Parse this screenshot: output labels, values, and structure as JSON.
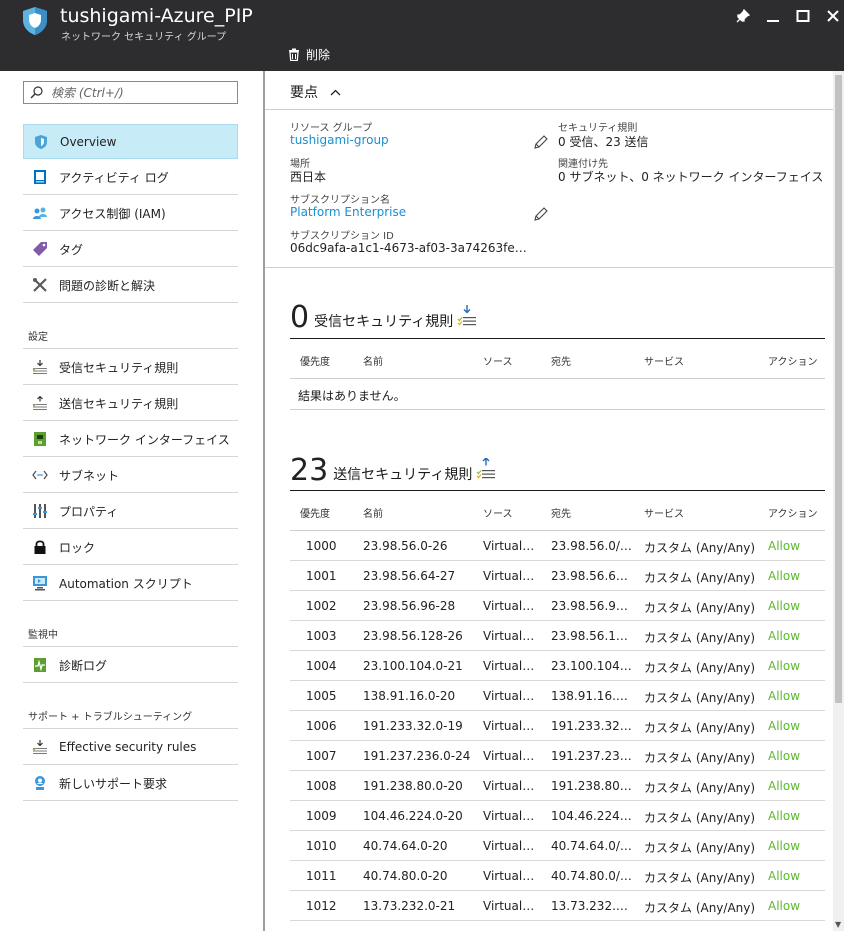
{
  "header": {
    "title": "tushigami-Azure_PIP",
    "subtitle": "ネットワーク セキュリティ グループ",
    "delete_label": "削除"
  },
  "search": {
    "placeholder": "検索 (Ctrl+/)"
  },
  "nav": {
    "overview": "Overview",
    "activity_log": "アクティビティ ログ",
    "iam": "アクセス制御 (IAM)",
    "tags": "タグ",
    "diagnose": "問題の診断と解決",
    "settings_label": "設定",
    "inbound": "受信セキュリティ規則",
    "outbound": "送信セキュリティ規則",
    "nics": "ネットワーク インターフェイス",
    "subnets": "サブネット",
    "properties": "プロパティ",
    "locks": "ロック",
    "automation": "Automation スクリプト",
    "monitoring_label": "監視中",
    "diag_logs": "診断ログ",
    "support_label": "サポート + トラブルシューティング",
    "effective_rules": "Effective security rules",
    "new_support": "新しいサポート要求"
  },
  "essentials": {
    "heading": "要点",
    "resource_group_label": "リソース グループ",
    "resource_group": "tushigami-group",
    "location_label": "場所",
    "location": "西日本",
    "subscription_label": "サブスクリプション名",
    "subscription": "Platform Enterprise",
    "subscription_id_label": "サブスクリプション ID",
    "subscription_id": "06dc9afa-a1c1-4673-af03-3a74263fe…",
    "security_rules_label": "セキュリティ規則",
    "security_rules": "0 受信、23 送信",
    "associated_label": "関連付け先",
    "associated": "0 サブネット、0 ネットワーク インターフェイス"
  },
  "columns": {
    "priority": "優先度",
    "name": "名前",
    "source": "ソース",
    "destination": "宛先",
    "service": "サービス",
    "action": "アクション"
  },
  "inbound": {
    "count": "0",
    "title": "受信セキュリティ規則",
    "empty": "結果はありません。"
  },
  "outbound": {
    "count": "23",
    "title": "送信セキュリティ規則",
    "rows": [
      {
        "priority": "1000",
        "name": "23.98.56.0-26",
        "source": "Virtual…",
        "destination": "23.98.56.0/…",
        "service": "カスタム (Any/Any)",
        "action": "Allow"
      },
      {
        "priority": "1001",
        "name": "23.98.56.64-27",
        "source": "Virtual…",
        "destination": "23.98.56.6…",
        "service": "カスタム (Any/Any)",
        "action": "Allow"
      },
      {
        "priority": "1002",
        "name": "23.98.56.96-28",
        "source": "Virtual…",
        "destination": "23.98.56.9…",
        "service": "カスタム (Any/Any)",
        "action": "Allow"
      },
      {
        "priority": "1003",
        "name": "23.98.56.128-26",
        "source": "Virtual…",
        "destination": "23.98.56.1…",
        "service": "カスタム (Any/Any)",
        "action": "Allow"
      },
      {
        "priority": "1004",
        "name": "23.100.104.0-21",
        "source": "Virtual…",
        "destination": "23.100.104…",
        "service": "カスタム (Any/Any)",
        "action": "Allow"
      },
      {
        "priority": "1005",
        "name": "138.91.16.0-20",
        "source": "Virtual…",
        "destination": "138.91.16.…",
        "service": "カスタム (Any/Any)",
        "action": "Allow"
      },
      {
        "priority": "1006",
        "name": "191.233.32.0-19",
        "source": "Virtual…",
        "destination": "191.233.32…",
        "service": "カスタム (Any/Any)",
        "action": "Allow"
      },
      {
        "priority": "1007",
        "name": "191.237.236.0-24",
        "source": "Virtual…",
        "destination": "191.237.23…",
        "service": "カスタム (Any/Any)",
        "action": "Allow"
      },
      {
        "priority": "1008",
        "name": "191.238.80.0-20",
        "source": "Virtual…",
        "destination": "191.238.80…",
        "service": "カスタム (Any/Any)",
        "action": "Allow"
      },
      {
        "priority": "1009",
        "name": "104.46.224.0-20",
        "source": "Virtual…",
        "destination": "104.46.224…",
        "service": "カスタム (Any/Any)",
        "action": "Allow"
      },
      {
        "priority": "1010",
        "name": "40.74.64.0-20",
        "source": "Virtual…",
        "destination": "40.74.64.0/…",
        "service": "カスタム (Any/Any)",
        "action": "Allow"
      },
      {
        "priority": "1011",
        "name": "40.74.80.0-20",
        "source": "Virtual…",
        "destination": "40.74.80.0/…",
        "service": "カスタム (Any/Any)",
        "action": "Allow"
      },
      {
        "priority": "1012",
        "name": "13.73.232.0-21",
        "source": "Virtual…",
        "destination": "13.73.232.…",
        "service": "カスタム (Any/Any)",
        "action": "Allow"
      }
    ]
  },
  "colors": {
    "header_bg": "#2d2d30",
    "link": "#1a8fd1",
    "allow": "#5cb82f",
    "active_nav": "#c7ecf7"
  }
}
